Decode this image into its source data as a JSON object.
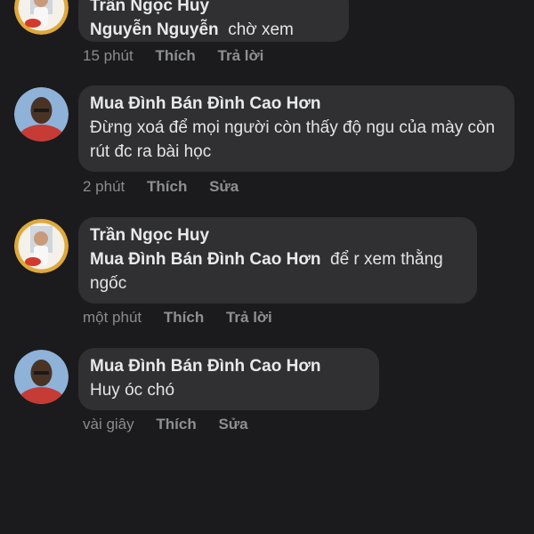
{
  "comments": [
    {
      "author": "Trần Ngọc Huy",
      "mention": "Nguyễn Nguyễn",
      "text": "chờ xem",
      "time": "15 phút",
      "like_label": "Thích",
      "action_label": "Trả lời"
    },
    {
      "author": "Mua Đình Bán Đình Cao Hơn",
      "text": "Đừng xoá để mọi người còn thấy độ ngu của mày còn rút đc ra bài học",
      "time": "2 phút",
      "like_label": "Thích",
      "action_label": "Sửa"
    },
    {
      "author": "Trần Ngọc Huy",
      "mention": "Mua Đình Bán Đình Cao Hơn",
      "text": "để r xem thằng ngốc",
      "time": "một phút",
      "like_label": "Thích",
      "action_label": "Trả lời"
    },
    {
      "author": "Mua Đình Bán Đình Cao Hơn",
      "text": "Huy óc chó",
      "time": "vài giây",
      "like_label": "Thích",
      "action_label": "Sửa"
    }
  ]
}
